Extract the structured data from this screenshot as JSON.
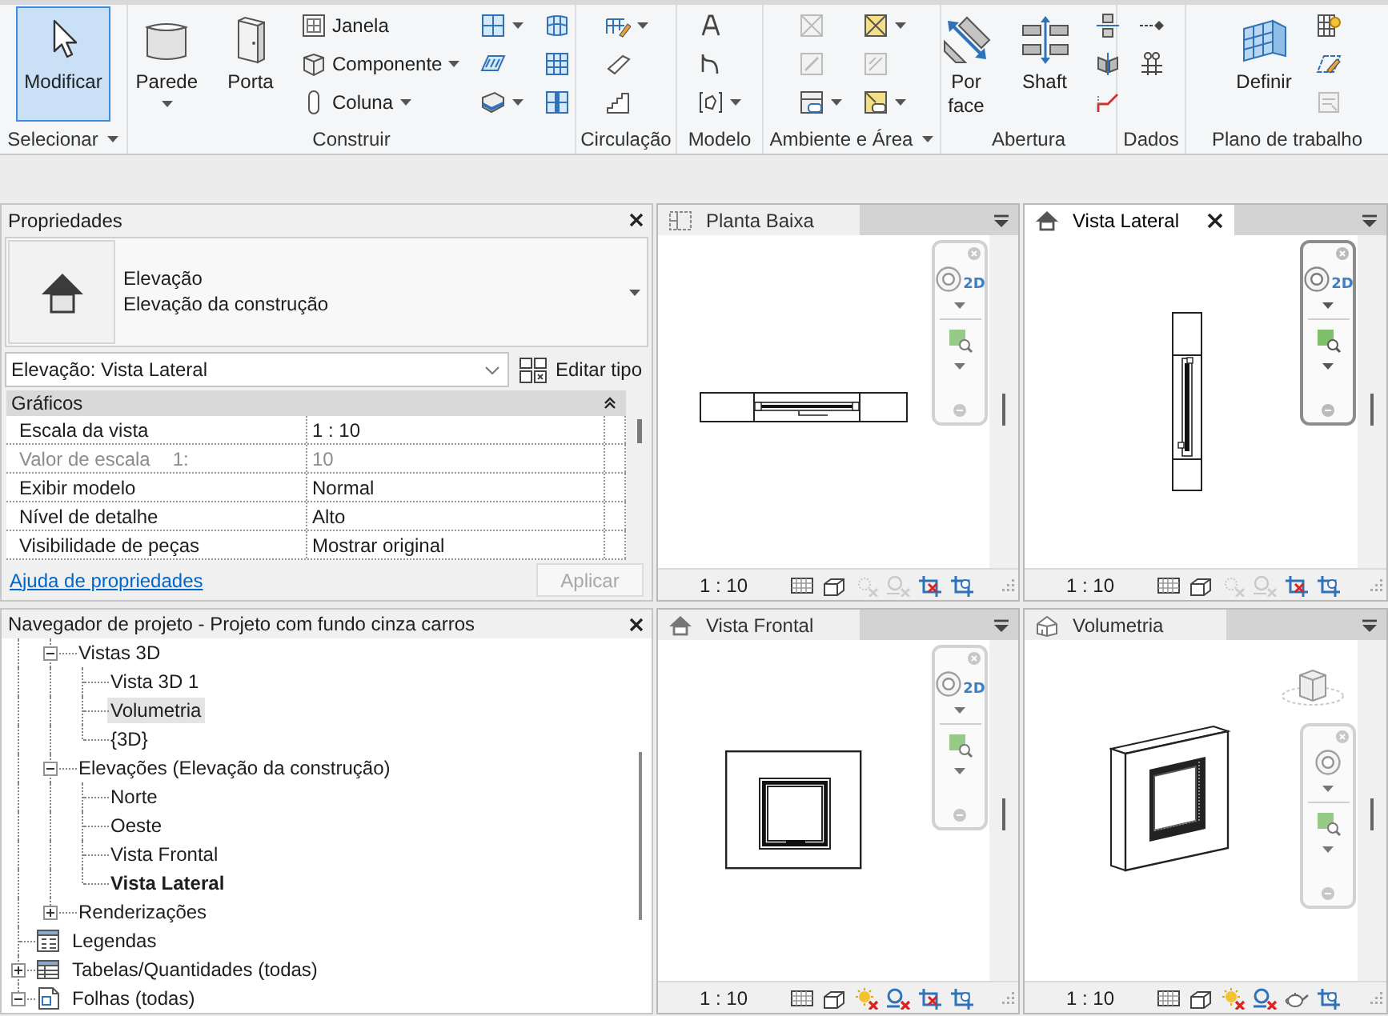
{
  "ribbon": {
    "panels": [
      {
        "title": "Selecionar",
        "menu": true,
        "tools": [
          {
            "kind": "large",
            "label": "Modificar",
            "selected": true,
            "disabled": false,
            "dropdown": false
          }
        ]
      },
      {
        "title": "Construir",
        "menu": false,
        "tools": [
          {
            "kind": "large",
            "label": "Parede",
            "selected": false,
            "disabled": false,
            "dropdown": true
          },
          {
            "kind": "large",
            "label": "Porta",
            "selected": false,
            "disabled": false,
            "dropdown": false
          },
          {
            "kind": "small",
            "label": "Janela",
            "selected": false,
            "disabled": false,
            "dropdown": false
          },
          {
            "kind": "small",
            "label": "Componente",
            "selected": false,
            "disabled": false,
            "dropdown": true
          },
          {
            "kind": "small",
            "label": "Coluna",
            "selected": false,
            "disabled": false,
            "dropdown": true
          },
          {
            "kind": "icon",
            "selected": false,
            "disabled": false,
            "dropdown": true
          },
          {
            "kind": "icon",
            "selected": false,
            "disabled": false,
            "dropdown": false
          },
          {
            "kind": "icon",
            "selected": false,
            "disabled": false,
            "dropdown": true
          },
          {
            "kind": "icon",
            "selected": false,
            "disabled": false,
            "dropdown": false
          },
          {
            "kind": "icon",
            "selected": false,
            "disabled": false,
            "dropdown": false
          },
          {
            "kind": "icon",
            "selected": false,
            "disabled": false,
            "dropdown": false
          }
        ]
      },
      {
        "title": "Circulação",
        "menu": false,
        "tools": [
          {
            "kind": "icon",
            "selected": false,
            "disabled": false,
            "dropdown": true
          },
          {
            "kind": "icon",
            "selected": false,
            "disabled": false,
            "dropdown": false
          },
          {
            "kind": "icon",
            "selected": false,
            "disabled": false,
            "dropdown": false
          }
        ]
      },
      {
        "title": "Modelo",
        "menu": false,
        "tools": [
          {
            "kind": "icon",
            "selected": false,
            "disabled": false,
            "dropdown": false
          },
          {
            "kind": "icon",
            "selected": false,
            "disabled": false,
            "dropdown": false
          },
          {
            "kind": "icon",
            "selected": false,
            "disabled": false,
            "dropdown": true
          }
        ]
      },
      {
        "title": "Ambiente e Área",
        "menu": true,
        "tools": [
          {
            "kind": "icon",
            "selected": false,
            "disabled": true,
            "dropdown": false
          },
          {
            "kind": "icon",
            "selected": false,
            "disabled": true,
            "dropdown": false
          },
          {
            "kind": "icon",
            "selected": false,
            "disabled": false,
            "dropdown": true
          },
          {
            "kind": "icon",
            "selected": false,
            "disabled": false,
            "dropdown": true
          },
          {
            "kind": "icon",
            "selected": false,
            "disabled": true,
            "dropdown": false
          },
          {
            "kind": "icon",
            "selected": false,
            "disabled": false,
            "dropdown": true
          }
        ]
      },
      {
        "title": "Abertura",
        "menu": false,
        "tools": [
          {
            "kind": "large",
            "label": "Por face",
            "selected": false,
            "disabled": false,
            "dropdown": false
          },
          {
            "kind": "large",
            "label": "Shaft",
            "selected": false,
            "disabled": false,
            "dropdown": false
          },
          {
            "kind": "icon",
            "selected": false,
            "disabled": false,
            "dropdown": false
          },
          {
            "kind": "icon",
            "selected": false,
            "disabled": false,
            "dropdown": false
          },
          {
            "kind": "icon",
            "selected": false,
            "disabled": false,
            "dropdown": false
          }
        ]
      },
      {
        "title": "Dados",
        "menu": false,
        "tools": [
          {
            "kind": "icon",
            "selected": false,
            "disabled": false,
            "dropdown": false
          },
          {
            "kind": "icon",
            "selected": false,
            "disabled": false,
            "dropdown": false
          }
        ]
      },
      {
        "title": "Plano de trabalho",
        "menu": false,
        "tools": [
          {
            "kind": "large",
            "label": "Definir",
            "selected": false,
            "disabled": false,
            "dropdown": false
          },
          {
            "kind": "icon",
            "selected": false,
            "disabled": false,
            "dropdown": false
          },
          {
            "kind": "icon",
            "selected": false,
            "disabled": false,
            "dropdown": false
          },
          {
            "kind": "icon",
            "selected": false,
            "disabled": true,
            "dropdown": false
          }
        ]
      }
    ]
  },
  "properties": {
    "title": "Propriedades",
    "type": {
      "name": "Elevação",
      "family": "Elevação da construção"
    },
    "instance": "Elevação: Vista Lateral",
    "edit_type": "Editar tipo",
    "groups": [
      {
        "title": "Gráficos",
        "expanded": true,
        "rows": [
          {
            "name": "Escala da vista",
            "value": "1 : 10",
            "disabled": false
          },
          {
            "name": "Valor de escala",
            "unit": "1:",
            "value": "10",
            "disabled": true
          },
          {
            "name": "Exibir modelo",
            "value": "Normal",
            "disabled": false
          },
          {
            "name": "Nível de detalhe",
            "value": "Alto",
            "disabled": false
          },
          {
            "name": "Visibilidade de peças",
            "value": "Mostrar original",
            "disabled": false
          }
        ]
      }
    ],
    "help_link": "Ajuda de propriedades",
    "apply": {
      "label": "Aplicar",
      "disabled": true
    }
  },
  "project_browser": {
    "title": "Navegador de projeto - Projeto com fundo cinza carros",
    "tree": [
      {
        "kind": "continued",
        "children": [
          {
            "label": "Vistas 3D",
            "expanded": true,
            "selected": false,
            "children": [
              {
                "label": "Vista 3D 1",
                "selected": false,
                "current": false
              },
              {
                "label": "Volumetria",
                "selected": true,
                "current": false
              },
              {
                "label": "{3D}",
                "selected": false,
                "current": false
              }
            ]
          },
          {
            "label": "Elevações (Elevação da construção)",
            "expanded": true,
            "selected": false,
            "children": [
              {
                "label": "Norte",
                "selected": false,
                "current": false
              },
              {
                "label": "Oeste",
                "selected": false,
                "current": false
              },
              {
                "label": "Vista Frontal",
                "selected": false,
                "current": false
              },
              {
                "label": "Vista Lateral",
                "selected": false,
                "current": true
              }
            ]
          },
          {
            "label": "Renderizações",
            "expanded": false,
            "selected": false
          }
        ]
      },
      {
        "kind": "legends",
        "label": "Legendas",
        "selected": false
      },
      {
        "kind": "schedules",
        "label": "Tabelas/Quantidades (todas)",
        "expanded": false,
        "selected": false
      },
      {
        "kind": "sheets",
        "label": "Folhas (todas)",
        "expanded": true,
        "selected": false
      }
    ]
  },
  "views": [
    {
      "title": "Planta Baixa",
      "kind": "plan",
      "active": false,
      "wheel_label": "2D",
      "scale": "1 : 10",
      "sun_enabled": false
    },
    {
      "title": "Vista Lateral",
      "kind": "side",
      "active": true,
      "wheel_label": "2D",
      "scale": "1 : 10",
      "sun_enabled": false
    },
    {
      "title": "Vista Frontal",
      "kind": "front",
      "active": false,
      "wheel_label": "2D",
      "scale": "1 : 10",
      "sun_enabled": true
    },
    {
      "title": "Volumetria",
      "kind": "isometric",
      "active": false,
      "scale": "1 : 10",
      "sun_enabled": true
    }
  ]
}
